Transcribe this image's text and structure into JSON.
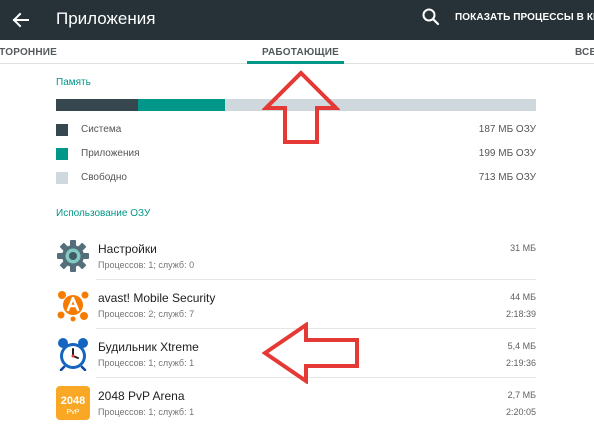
{
  "toolbar": {
    "title": "Приложения",
    "action_label": "ПОКАЗАТЬ ПРОЦЕССЫ В КЕШЕ"
  },
  "tabs": [
    {
      "label": "СТОРОННИЕ",
      "active": false
    },
    {
      "label": "РАБОТАЮЩИЕ",
      "active": true
    },
    {
      "label": "ВСЕ",
      "active": false
    }
  ],
  "memory": {
    "header": "Память",
    "total_mb": 1099,
    "segments": [
      {
        "label": "Система",
        "value": "187 МБ ОЗУ",
        "mb": 187,
        "color": "#37474f"
      },
      {
        "label": "Приложения",
        "value": "199 МБ ОЗУ",
        "mb": 199,
        "color": "#009688"
      },
      {
        "label": "Свободно",
        "value": "713 МБ ОЗУ",
        "mb": 713,
        "color": "#cfd8dc"
      }
    ]
  },
  "ram_usage": {
    "header": "Использование ОЗУ",
    "processes": [
      {
        "name": "Настройки",
        "details": "Процессов: 1; служб: 0",
        "size": "31 МБ",
        "time": "",
        "icon": "settings-gear-icon"
      },
      {
        "name": "avast! Mobile Security",
        "details": "Процессов: 2; служб: 7",
        "size": "44 МБ",
        "time": "2:18:39",
        "icon": "avast-icon"
      },
      {
        "name": "Будильник Xtreme",
        "details": "Процессов: 1; служб: 1",
        "size": "5,4 МБ",
        "time": "2:19:36",
        "icon": "alarm-clock-icon"
      },
      {
        "name": "2048 PvP Arena",
        "details": "Процессов: 1; служб: 1",
        "size": "2,7 МБ",
        "time": "2:20:05",
        "icon": "game-2048-icon"
      }
    ]
  },
  "icon_2048": {
    "number": "2048",
    "sub": "PvP"
  },
  "colors": {
    "toolbar": "#263238",
    "accent": "#009688",
    "annotation_red": "#e53935"
  }
}
